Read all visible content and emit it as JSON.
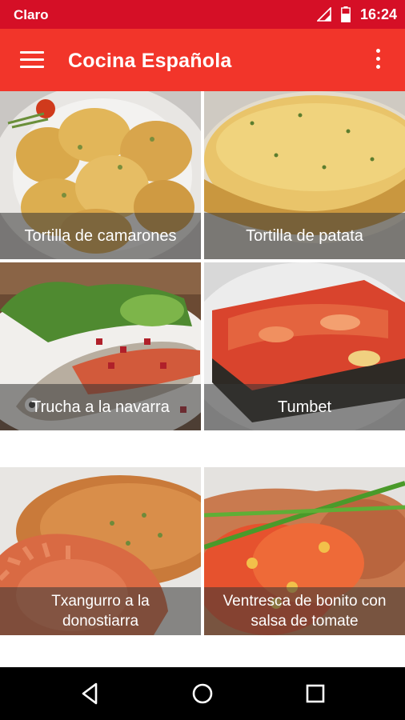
{
  "status_bar": {
    "carrier": "Claro",
    "time": "16:24",
    "icons": [
      "signal-icon",
      "battery-icon"
    ]
  },
  "app_bar": {
    "title": "Cocina Española",
    "menu_icon": "hamburger-menu-icon",
    "overflow_icon": "more-vert-icon",
    "color": "#f2352a"
  },
  "recipes": [
    {
      "label": "Tortilla de camarones"
    },
    {
      "label": "Tortilla de patata"
    },
    {
      "label": "Trucha a la navarra"
    },
    {
      "label": "Tumbet"
    },
    {
      "label": "Txangurro a la donostiarra"
    },
    {
      "label": "Ventresca de bonito con salsa de tomate"
    }
  ],
  "nav_bar": {
    "icons": [
      "back-icon",
      "home-icon",
      "recents-icon"
    ]
  }
}
